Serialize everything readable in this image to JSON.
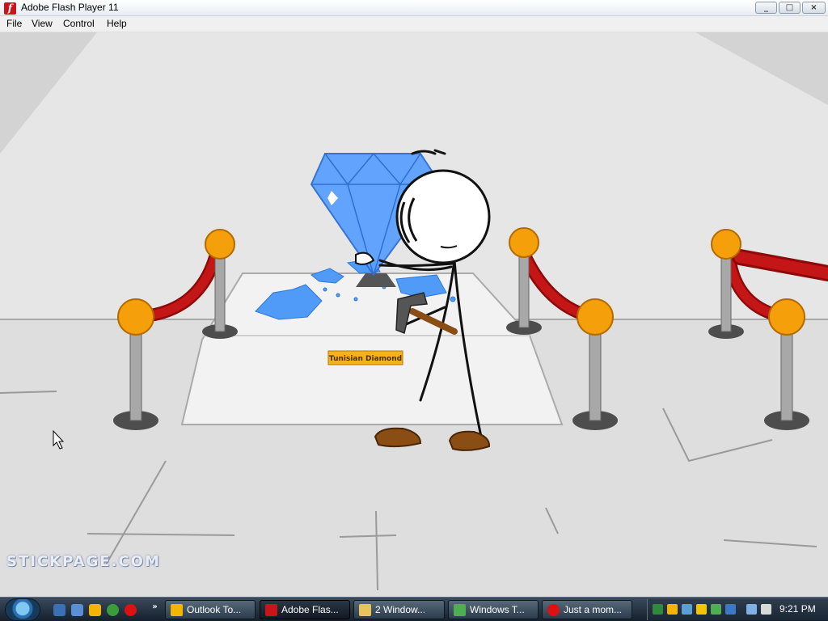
{
  "window": {
    "title": "Adobe Flash Player 11",
    "app_icon": "flash-f-icon",
    "controls": {
      "minimize": "_",
      "maximize": "□",
      "close": "×"
    }
  },
  "menu": [
    {
      "label": "File"
    },
    {
      "label": "View"
    },
    {
      "label": "Control"
    },
    {
      "label": "Help"
    }
  ],
  "game": {
    "watermark": "STICKPAGE.COM",
    "plaque_text": "Tunisian Diamond",
    "colors": {
      "diamond": "#5aa0ff",
      "rope": "#c01010",
      "post_cap": "#f5a00a",
      "shoes": "#8a4d14",
      "floor": "#dedede",
      "wall": "#e6e6e6"
    }
  },
  "taskbar": {
    "quick_launch": [
      {
        "icon": "show-desktop-icon"
      },
      {
        "icon": "switch-windows-icon"
      },
      {
        "icon": "outlook-icon"
      },
      {
        "icon": "chrome-icon"
      },
      {
        "icon": "opera-icon"
      }
    ],
    "overflow": "»",
    "tasks": [
      {
        "label": "Outlook To...",
        "icon": "outlook-icon",
        "color": "#f4b400",
        "active": false
      },
      {
        "label": "Adobe Flas...",
        "icon": "flash-icon",
        "color": "#c9141a",
        "active": true
      },
      {
        "label": "2 Window...",
        "icon": "folder-icon",
        "color": "#e8c45a",
        "active": false
      },
      {
        "label": "Windows T...",
        "icon": "task-manager-icon",
        "color": "#4caf50",
        "active": false
      },
      {
        "label": "Just a mom...",
        "icon": "opera-icon",
        "color": "#d11",
        "active": false
      }
    ],
    "clock": "9:21 PM"
  }
}
